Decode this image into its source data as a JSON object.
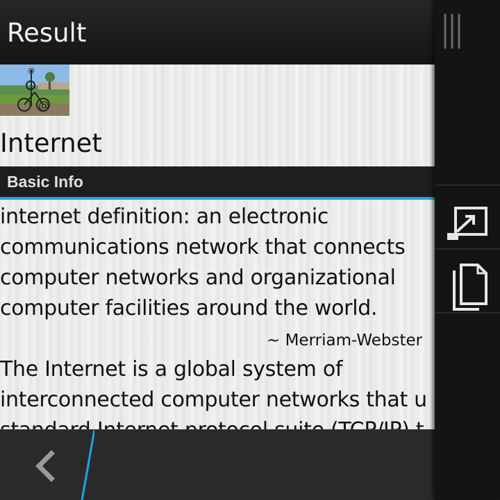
{
  "header": {
    "title": "Result"
  },
  "content": {
    "heading": "Internet",
    "section_label": "Basic Info",
    "definition": "internet definition: an electronic communications network that connects computer networks and organizational computer facilities around the world.",
    "source": "~ Merriam-Webster",
    "body_lines": [
      "The Internet is a global system of",
      "interconnected computer networks that u",
      "standard Internet protocol suite (TCP/IP) t"
    ]
  },
  "actions": [
    {
      "name": "resize-icon"
    },
    {
      "name": "copy-icon"
    }
  ],
  "bottom": {
    "back_icon": "chevron-left-icon"
  },
  "colors": {
    "accent": "#1aa6e3",
    "bar": "#1e1e1e",
    "panel": "#141414"
  }
}
